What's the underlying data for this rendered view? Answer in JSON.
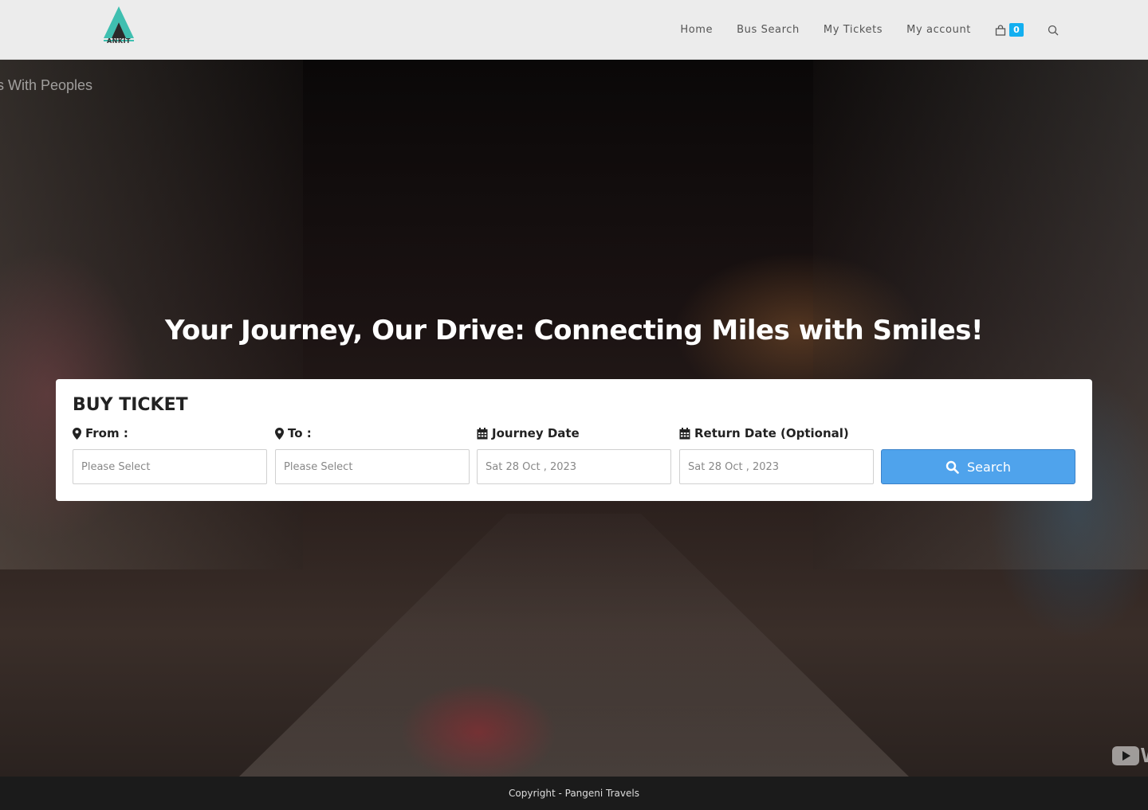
{
  "brand": {
    "logo_text": "ANKIT"
  },
  "nav": {
    "items": [
      "Home",
      "Bus Search",
      "My Tickets",
      "My account"
    ],
    "cart_count": "0",
    "cart_icon": "shopping-bag-icon",
    "search_icon": "search-icon"
  },
  "hero": {
    "ticker": "us With Peoples",
    "tagline": "Your Journey, Our Drive: Connecting Miles with Smiles!",
    "video_badge": "W"
  },
  "booking": {
    "title": "BUY TICKET",
    "from_label": "From :",
    "from_value": "Please Select",
    "to_label": "To :",
    "to_value": "Please Select",
    "journey_label": "Journey Date",
    "journey_value": "Sat 28 Oct , 2023",
    "return_label": "Return Date (Optional)",
    "return_value": "Sat 28 Oct , 2023",
    "search_label": "Search"
  },
  "footer": {
    "copyright": "Copyright - Pangeni Travels"
  },
  "colors": {
    "accent": "#13aff0",
    "search_button": "#4fa3ec",
    "logo_teal": "#3fbfb0"
  }
}
